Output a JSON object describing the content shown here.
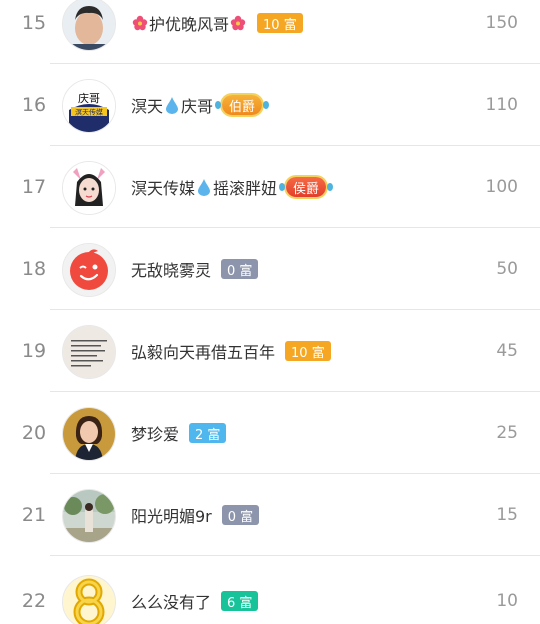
{
  "rows": [
    {
      "rank": "15",
      "name": "护优晚风哥",
      "flowers": true,
      "badge": {
        "kind": "rich",
        "text": "10 富",
        "color": "#f5a623"
      },
      "score": "150",
      "avatar": "man-photo"
    },
    {
      "rank": "16",
      "name_parts": [
        "溟天",
        "庆哥"
      ],
      "badge": {
        "kind": "title",
        "text": "伯爵",
        "color": "#f5a02a"
      },
      "score": "110",
      "avatar": "logo-qingge",
      "avatar_text": {
        "top": "庆哥",
        "bottom": "溟天传媒"
      }
    },
    {
      "rank": "17",
      "name_parts": [
        "溟天传媒",
        "摇滚胖妞"
      ],
      "badge": {
        "kind": "title",
        "text": "侯爵",
        "color": "#f05a3c"
      },
      "score": "100",
      "avatar": "girl-cartoon"
    },
    {
      "rank": "18",
      "name": "无敌晓雾灵",
      "badge": {
        "kind": "rich",
        "text": "0 富",
        "color": "#8c95ab"
      },
      "score": "50",
      "avatar": "red-wink-face"
    },
    {
      "rank": "19",
      "name": "弘毅向天再借五百年",
      "badge": {
        "kind": "rich",
        "text": "10 富",
        "color": "#f5a623"
      },
      "score": "45",
      "avatar": "text-image"
    },
    {
      "rank": "20",
      "name": "梦珍爱",
      "badge": {
        "kind": "rich",
        "text": "2 富",
        "color": "#4fb7ee"
      },
      "score": "25",
      "avatar": "woman-photo"
    },
    {
      "rank": "21",
      "name": "阳光明媚9r",
      "badge": {
        "kind": "rich",
        "text": "0 富",
        "color": "#8c95ab"
      },
      "score": "15",
      "avatar": "park-photo"
    },
    {
      "rank": "22",
      "name": "么么没有了",
      "badge": {
        "kind": "rich",
        "text": "6 富",
        "color": "#19c39a"
      },
      "score": "10",
      "avatar": "gold-eight"
    }
  ],
  "icons": {
    "flower": "hibiscus-icon",
    "drop": "water-drop-icon"
  }
}
